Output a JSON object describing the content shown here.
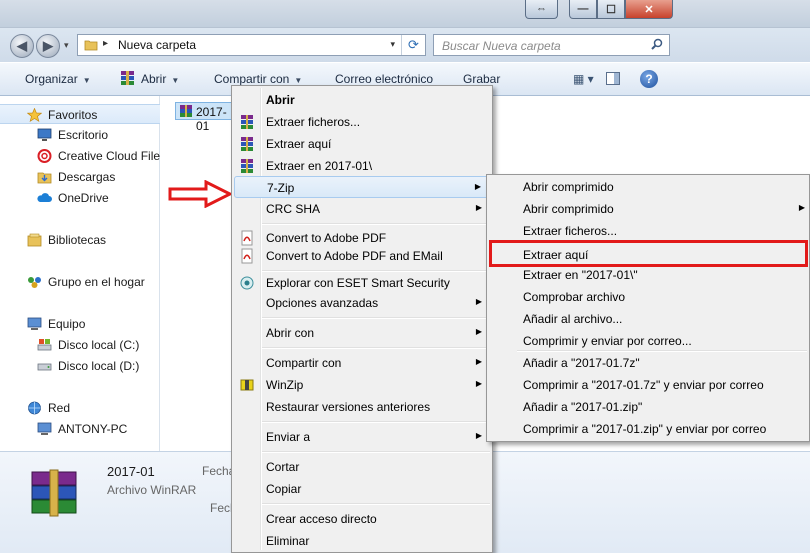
{
  "window": {
    "min_glyph": "—",
    "max_glyph": "☐",
    "close_glyph": "✕",
    "restore_glyph": "⇔"
  },
  "address": {
    "path_sep": "▸",
    "folder": "Nueva carpeta",
    "dropdown_glyph": "▾",
    "refresh_glyph": "⟳"
  },
  "search": {
    "placeholder": "Buscar Nueva carpeta"
  },
  "nav_buttons": {
    "back": "◀",
    "forward": "▶",
    "history": "▾"
  },
  "toolbar": {
    "organizar": "Organizar",
    "abrir": "Abrir",
    "compartir": "Compartir con",
    "correo": "Correo electrónico",
    "grabar": "Grabar",
    "arrow": "▼",
    "view_glyph": "▦ ▾",
    "help_glyph": "?"
  },
  "navpane": {
    "favoritos": "Favoritos",
    "escritorio": "Escritorio",
    "creative_cloud": "Creative Cloud Files",
    "descargas": "Descargas",
    "onedrive": "OneDrive",
    "bibliotecas": "Bibliotecas",
    "grupo_hogar": "Grupo en el hogar",
    "equipo": "Equipo",
    "disco_c": "Disco local (C:)",
    "disco_d": "Disco local (D:)",
    "red": "Red",
    "antony_pc": "ANTONY-PC"
  },
  "file": {
    "label": "2017-01"
  },
  "details": {
    "name": "2017-01",
    "type": "Archivo WinRAR",
    "fecha1": "Fecha",
    "fecha2": "Fech"
  },
  "context_menu": {
    "submenu_glyph": "▶",
    "items": [
      "Abrir",
      "Extraer ficheros...",
      "Extraer aquí",
      "Extraer en 2017-01\\",
      "7-Zip",
      "CRC SHA",
      "Convert to Adobe PDF",
      "Convert to Adobe PDF and EMail",
      "Explorar con ESET Smart Security",
      "Opciones avanzadas",
      "Abrir con",
      "Compartir con",
      "WinZip",
      "Restaurar versiones anteriores",
      "Enviar a",
      "Cortar",
      "Copiar",
      "Crear acceso directo",
      "Eliminar"
    ]
  },
  "submenu_7zip": {
    "items": [
      "Abrir comprimido",
      "Abrir comprimido",
      "Extraer ficheros...",
      "Extraer aquí",
      "Extraer en \"2017-01\\\"",
      "Comprobar archivo",
      "Añadir al archivo...",
      "Comprimir y enviar por correo...",
      "Añadir a \"2017-01.7z\"",
      "Comprimir a \"2017-01.7z\" y enviar por correo",
      "Añadir a \"2017-01.zip\"",
      "Comprimir a \"2017-01.zip\" y enviar por correo"
    ]
  },
  "colors": {
    "annotation_red": "#e21a1a",
    "menu_bg": "#f0f0f0",
    "highlight": "#d9e9f8"
  }
}
